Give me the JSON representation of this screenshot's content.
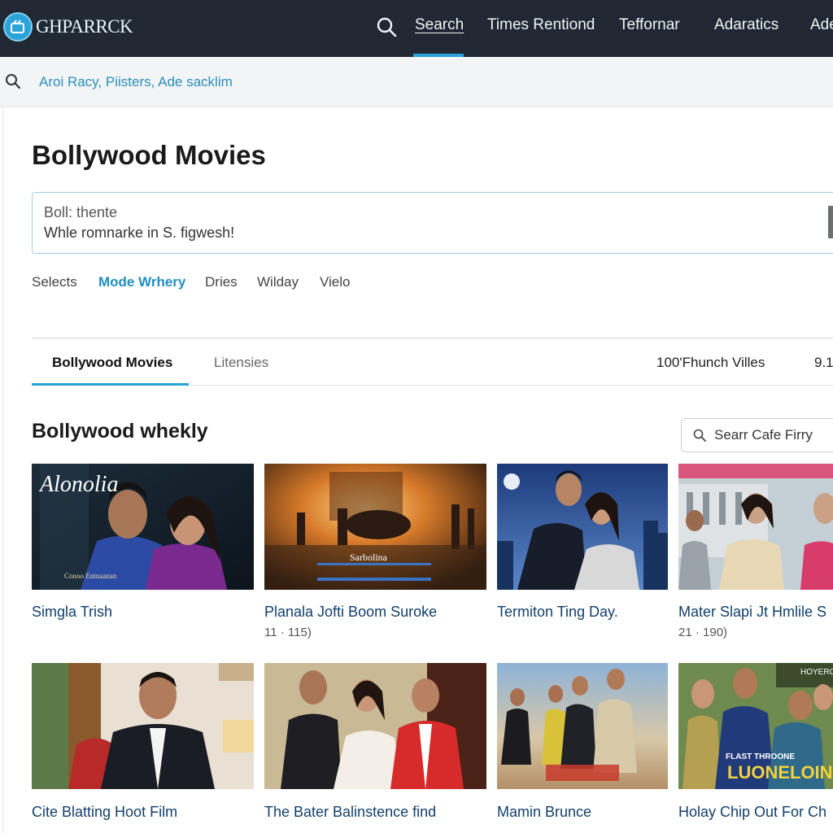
{
  "header": {
    "logo_text": "GHPARRCK",
    "nav": [
      "Search",
      "Times Rentiond",
      "Teffornar",
      "Adaratics",
      "Ade"
    ]
  },
  "subbar": {
    "text": "Aroi Racy, Piisters, Ade sacklim"
  },
  "page": {
    "title": "Bollywood Movies",
    "textbox_line1": "Boll: thente",
    "textbox_line2": "Whle romnarke in S. figwesh!"
  },
  "filters": [
    "Selects",
    "Mode Wrhery",
    "Dries",
    "Wilday",
    "Vielo"
  ],
  "tabs": {
    "active": "Bollywood Movies",
    "inactive": "Litensies",
    "right_1": "100'Fhunch Villes",
    "right_2": "9.1"
  },
  "section": {
    "title": "Bollywood whekly",
    "search_placeholder": "Searr Cafe Firry"
  },
  "cards": [
    {
      "title": "Simgla Trish",
      "meta": "",
      "poster_text": "Alonolia",
      "poster_sub": "Conoo Entnaanan"
    },
    {
      "title": "Planala Jofti Boom Suroke",
      "meta": "11 · 115)",
      "poster_text": "Sarbolina"
    },
    {
      "title": "Termiton Ting Day.",
      "meta": ""
    },
    {
      "title": "Mater Slapi Jt Hmlile S",
      "meta": "21 · 190)"
    },
    {
      "title": "Cite Blatting Hoot Film",
      "meta": ""
    },
    {
      "title": "The Bater Balinstence find",
      "meta": ""
    },
    {
      "title": "Mamin Brunce",
      "meta": ""
    },
    {
      "title": "Holay Chip Out For Ch",
      "meta": "",
      "poster_text": "LUONELOINE",
      "poster_sub": "FLAST THROONE"
    }
  ],
  "colors": {
    "nav_bg": "#1f2833",
    "accent": "#2aa3d8",
    "link": "#123f6a"
  }
}
